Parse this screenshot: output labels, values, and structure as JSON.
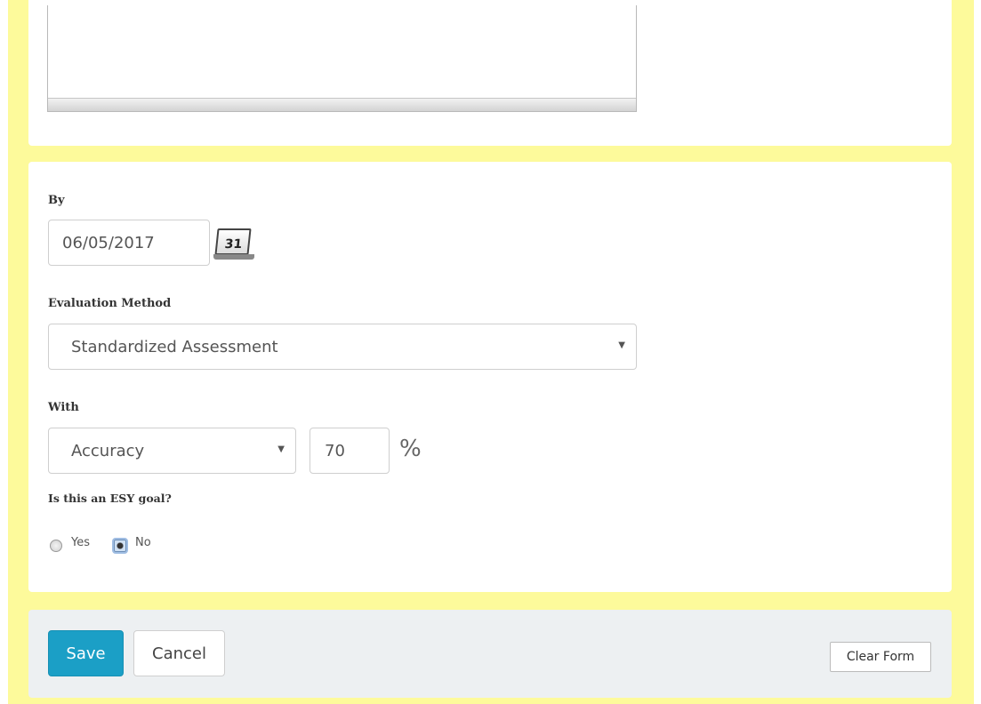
{
  "form": {
    "by_label": "By",
    "by_date": "06/05/2017",
    "calendar_icon": "calendar-icon",
    "calendar_day": "31",
    "evaluation_method_label": "Evaluation Method",
    "evaluation_method_value": "Standardized Assessment",
    "with_label": "With",
    "with_value": "Accuracy",
    "percent_value": "70",
    "percent_sign": "%",
    "esy_label": "Is this an ESY goal?",
    "esy_options": [
      {
        "label": "Yes",
        "selected": false
      },
      {
        "label": "No",
        "selected": true
      }
    ]
  },
  "footer": {
    "save_label": "Save",
    "cancel_label": "Cancel",
    "clear_label": "Clear Form"
  },
  "colors": {
    "frame_background": "#fdfa9b",
    "save_button": "#1b9fc6",
    "footer_background": "#edf0f2"
  }
}
